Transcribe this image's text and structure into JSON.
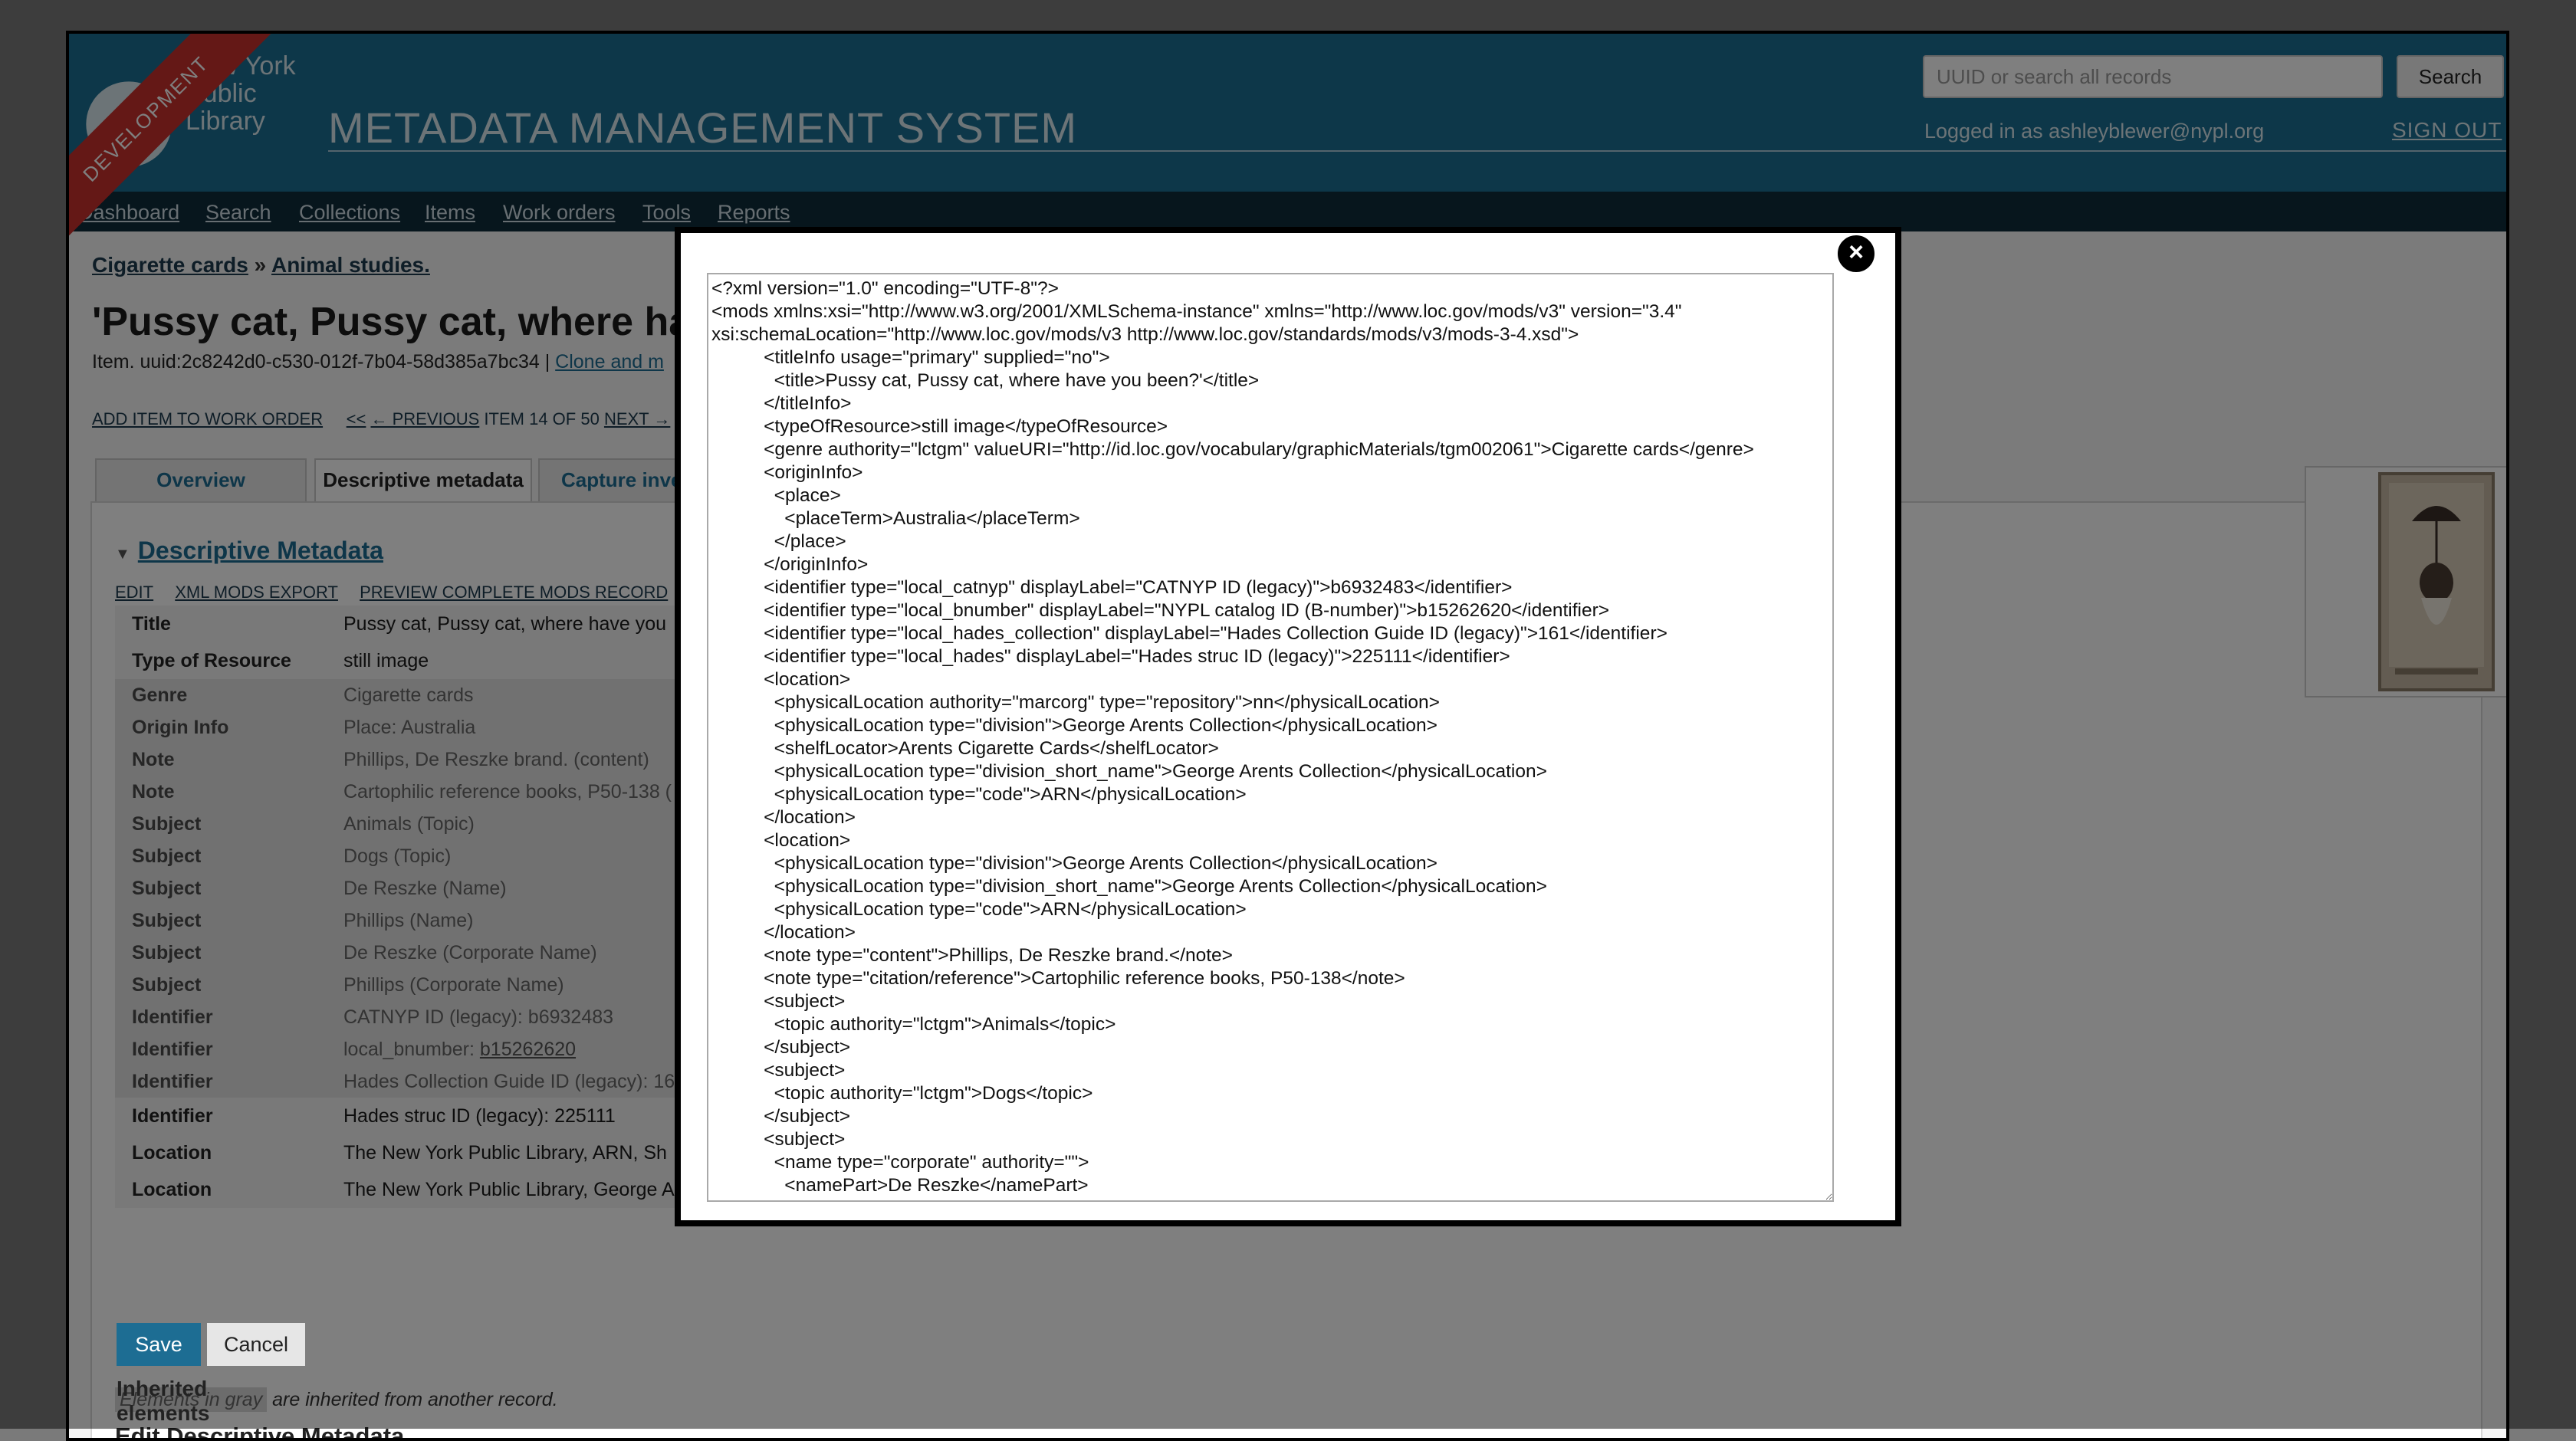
{
  "header": {
    "logo_text": "New York\nPublic\nLibrary",
    "app_title": "METADATA MANAGEMENT SYSTEM",
    "search_placeholder": "UUID or search all records",
    "search_label": "Search",
    "logged_in": "Logged in as ashleyblewer@nypl.org",
    "sign_out": "SIGN OUT"
  },
  "nav": [
    "Dashboard",
    "Search",
    "Collections",
    "Items",
    "Work orders",
    "Tools",
    "Reports"
  ],
  "dev_banner": "DEVELOPMENT",
  "breadcrumb": {
    "item1": "Cigarette cards",
    "sep": " » ",
    "item2": "Animal studies."
  },
  "page_title": "'Pussy cat, Pussy cat, where ha",
  "item_uuid": "Item. uuid:2c8242d0-c530-012f-7b04-58d385a7bc34 | ",
  "clone_link": "Clone and m",
  "actions": {
    "add_to_work_order": "ADD ITEM TO WORK ORDER",
    "first": "<<",
    "previous": "← PREVIOUS",
    "position": "ITEM 14 OF 50",
    "next": "NEXT →"
  },
  "tabs": [
    "Overview",
    "Descriptive metadata",
    "Capture inve"
  ],
  "section": {
    "title": "Descriptive Metadata",
    "links": [
      "EDIT",
      "XML MODS EXPORT",
      "PREVIEW COMPLETE MODS RECORD"
    ]
  },
  "metadata_rows": [
    {
      "k": "Title",
      "v": "Pussy cat, Pussy cat, where have you"
    },
    {
      "k": "Type of Resource",
      "v": "still image"
    },
    {
      "k": "Genre",
      "v": "Cigarette cards"
    },
    {
      "k": "Origin Info",
      "v": "Place: Australia"
    },
    {
      "k": "Note",
      "v": "Phillips, De Reszke brand. (content)"
    },
    {
      "k": "Note",
      "v": "Cartophilic reference books, P50-138 ("
    },
    {
      "k": "Subject",
      "v": "Animals (Topic)"
    },
    {
      "k": "Subject",
      "v": "Dogs (Topic)"
    },
    {
      "k": "Subject",
      "v": "De Reszke (Name)"
    },
    {
      "k": "Subject",
      "v": "Phillips (Name)"
    },
    {
      "k": "Subject",
      "v": "De Reszke (Corporate Name)"
    },
    {
      "k": "Subject",
      "v": "Phillips (Corporate Name)"
    },
    {
      "k": "Identifier",
      "v": "CATNYP ID (legacy): b6932483"
    },
    {
      "k": "Identifier",
      "v": "local_bnumber: ",
      "link": "b15262620"
    },
    {
      "k": "Identifier",
      "v": "Hades Collection Guide ID (legacy): 16"
    },
    {
      "k": "Identifier",
      "v": "Hades struc ID (legacy): 225111"
    },
    {
      "k": "Location",
      "v": "The New York Public Library, ARN, Sh"
    },
    {
      "k": "Location",
      "v": "The New York Public Library, George A"
    }
  ],
  "inherited_note": {
    "chip": "Elements in gray",
    "rest": " are inherited from another record."
  },
  "edit_heading": "Edit Descriptive Metadata",
  "save_label": "Save",
  "cancel_label": "Cancel",
  "inherited_elements": "Inherited elements",
  "modal": {
    "close": "×",
    "xml": "<?xml version=\"1.0\" encoding=\"UTF-8\"?>\n<mods xmlns:xsi=\"http://www.w3.org/2001/XMLSchema-instance\" xmlns=\"http://www.loc.gov/mods/v3\" version=\"3.4\"\nxsi:schemaLocation=\"http://www.loc.gov/mods/v3 http://www.loc.gov/standards/mods/v3/mods-3-4.xsd\">\n          <titleInfo usage=\"primary\" supplied=\"no\">\n            <title>Pussy cat, Pussy cat, where have you been?'</title>\n          </titleInfo>\n          <typeOfResource>still image</typeOfResource>\n          <genre authority=\"lctgm\" valueURI=\"http://id.loc.gov/vocabulary/graphicMaterials/tgm002061\">Cigarette cards</genre>\n          <originInfo>\n            <place>\n              <placeTerm>Australia</placeTerm>\n            </place>\n          </originInfo>\n          <identifier type=\"local_catnyp\" displayLabel=\"CATNYP ID (legacy)\">b6932483</identifier>\n          <identifier type=\"local_bnumber\" displayLabel=\"NYPL catalog ID (B-number)\">b15262620</identifier>\n          <identifier type=\"local_hades_collection\" displayLabel=\"Hades Collection Guide ID (legacy)\">161</identifier>\n          <identifier type=\"local_hades\" displayLabel=\"Hades struc ID (legacy)\">225111</identifier>\n          <location>\n            <physicalLocation authority=\"marcorg\" type=\"repository\">nn</physicalLocation>\n            <physicalLocation type=\"division\">George Arents Collection</physicalLocation>\n            <shelfLocator>Arents Cigarette Cards</shelfLocator>\n            <physicalLocation type=\"division_short_name\">George Arents Collection</physicalLocation>\n            <physicalLocation type=\"code\">ARN</physicalLocation>\n          </location>\n          <location>\n            <physicalLocation type=\"division\">George Arents Collection</physicalLocation>\n            <physicalLocation type=\"division_short_name\">George Arents Collection</physicalLocation>\n            <physicalLocation type=\"code\">ARN</physicalLocation>\n          </location>\n          <note type=\"content\">Phillips, De Reszke brand.</note>\n          <note type=\"citation/reference\">Cartophilic reference books, P50-138</note>\n          <subject>\n            <topic authority=\"lctgm\">Animals</topic>\n          </subject>\n          <subject>\n            <topic authority=\"lctgm\">Dogs</topic>\n          </subject>\n          <subject>\n            <name type=\"corporate\" authority=\"\">\n              <namePart>De Reszke</namePart>"
  },
  "colors": {
    "header": "#1b6f93",
    "nav": "#0e2c3b",
    "banner": "#c9302c",
    "link": "#1d6d93"
  }
}
